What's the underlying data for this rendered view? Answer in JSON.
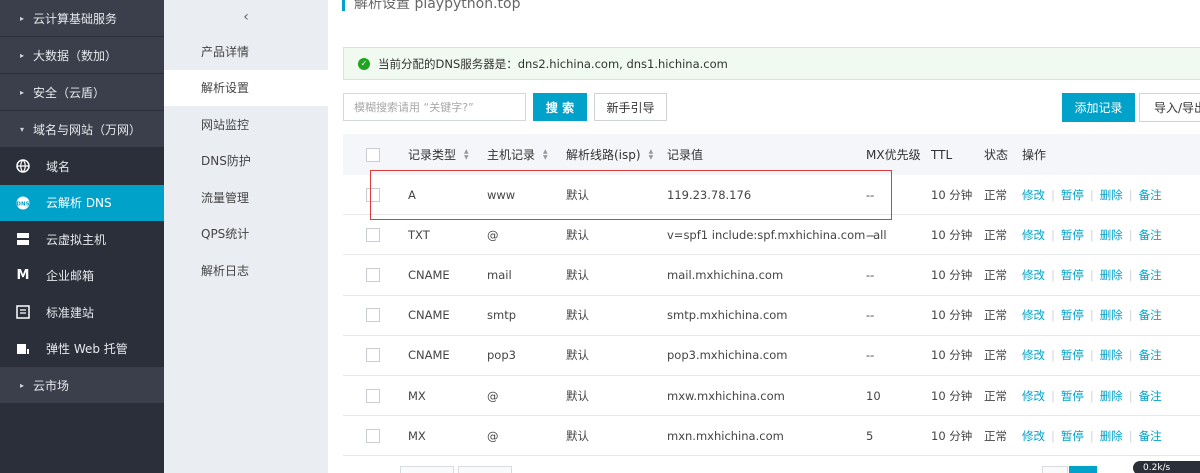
{
  "sidebar": {
    "items": [
      {
        "kind": "cat",
        "label": "云计算基础服务",
        "icon": "caret-right-icon"
      },
      {
        "kind": "cat",
        "label": "大数据（数加）",
        "icon": "caret-right-icon"
      },
      {
        "kind": "cat",
        "label": "安全（云盾）",
        "icon": "caret-right-icon"
      },
      {
        "kind": "cat",
        "label": "域名与网站（万网）",
        "icon": "caret-down-icon"
      },
      {
        "kind": "sub",
        "label": "域名",
        "icon": "globe-icon"
      },
      {
        "kind": "sub",
        "label": "云解析 DNS",
        "icon": "dns-icon",
        "active": true
      },
      {
        "kind": "sub",
        "label": "云虚拟主机",
        "icon": "server-icon"
      },
      {
        "kind": "sub",
        "label": "企业邮箱",
        "icon": "mail-m-icon"
      },
      {
        "kind": "sub",
        "label": "标准建站",
        "icon": "site-icon"
      },
      {
        "kind": "sub",
        "label": "弹性 Web 托管",
        "icon": "hosting-icon"
      },
      {
        "kind": "cat",
        "label": "云市场",
        "icon": "caret-right-icon"
      }
    ]
  },
  "subnav": {
    "back_icon": "chevron-left-icon",
    "items": [
      {
        "label": "产品详情"
      },
      {
        "label": "解析设置",
        "active": true
      },
      {
        "label": "网站监控"
      },
      {
        "label": "DNS防护"
      },
      {
        "label": "流量管理"
      },
      {
        "label": "QPS统计"
      },
      {
        "label": "解析日志"
      }
    ]
  },
  "header": {
    "title": "解析设置 playpython.top"
  },
  "notice": {
    "text": "当前分配的DNS服务器是：dns2.hichina.com, dns1.hichina.com"
  },
  "toolbar": {
    "search_placeholder": "模糊搜索请用 “关键字?”",
    "search_label": "搜 索",
    "guide_label": "新手引导",
    "add_label": "添加记录",
    "io_label": "导入/导出"
  },
  "table": {
    "columns": [
      "记录类型",
      "主机记录",
      "解析线路(isp)",
      "记录值",
      "MX优先级",
      "TTL",
      "状态",
      "操作"
    ],
    "actions": [
      "修改",
      "暂停",
      "删除",
      "备注"
    ],
    "rows": [
      {
        "type": "A",
        "host": "www",
        "line": "默认",
        "value": "119.23.78.176",
        "mx": "--",
        "ttl": "10 分钟",
        "status": "正常"
      },
      {
        "type": "TXT",
        "host": "@",
        "line": "默认",
        "value": "v=spf1 include:spf.mxhichina.com -all",
        "mx": "--",
        "ttl": "10 分钟",
        "status": "正常"
      },
      {
        "type": "CNAME",
        "host": "mail",
        "line": "默认",
        "value": "mail.mxhichina.com",
        "mx": "--",
        "ttl": "10 分钟",
        "status": "正常"
      },
      {
        "type": "CNAME",
        "host": "smtp",
        "line": "默认",
        "value": "smtp.mxhichina.com",
        "mx": "--",
        "ttl": "10 分钟",
        "status": "正常"
      },
      {
        "type": "CNAME",
        "host": "pop3",
        "line": "默认",
        "value": "pop3.mxhichina.com",
        "mx": "--",
        "ttl": "10 分钟",
        "status": "正常"
      },
      {
        "type": "MX",
        "host": "@",
        "line": "默认",
        "value": "mxw.mxhichina.com",
        "mx": "10",
        "ttl": "10 分钟",
        "status": "正常"
      },
      {
        "type": "MX",
        "host": "@",
        "line": "默认",
        "value": "mxn.mxhichina.com",
        "mx": "5",
        "ttl": "10 分钟",
        "status": "正常"
      }
    ]
  },
  "footer": {
    "speed": "0.2k/s"
  },
  "colors": {
    "accent": "#00a2ca",
    "sidebar": "#2b2f3a",
    "ok": "#1ea41e",
    "highlight": "#e03a3a"
  }
}
